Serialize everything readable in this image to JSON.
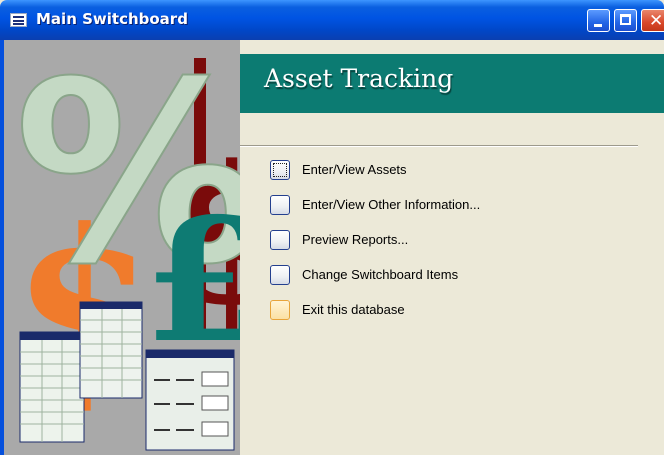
{
  "window": {
    "title": "Main Switchboard",
    "app_icon": "form-icon",
    "controls": [
      "minimize-icon",
      "maximize-icon",
      "close-icon"
    ],
    "accent_color": "#0054e3"
  },
  "switchboard": {
    "heading": "Asset Tracking",
    "heading_color": "#0c7b72",
    "items": [
      {
        "label": "Enter/View Assets",
        "state": "focused"
      },
      {
        "label": "Enter/View Other Information...",
        "state": "normal"
      },
      {
        "label": "Preview Reports...",
        "state": "normal"
      },
      {
        "label": "Change Switchboard Items",
        "state": "normal"
      },
      {
        "label": "Exit this database",
        "state": "hover"
      }
    ]
  },
  "decoration": {
    "symbols": [
      "%",
      "$",
      "£",
      "$"
    ],
    "symbol_colors": [
      "#c3d8c3",
      "#f07b2c",
      "#0e7b73",
      "#7a0b0b"
    ]
  }
}
